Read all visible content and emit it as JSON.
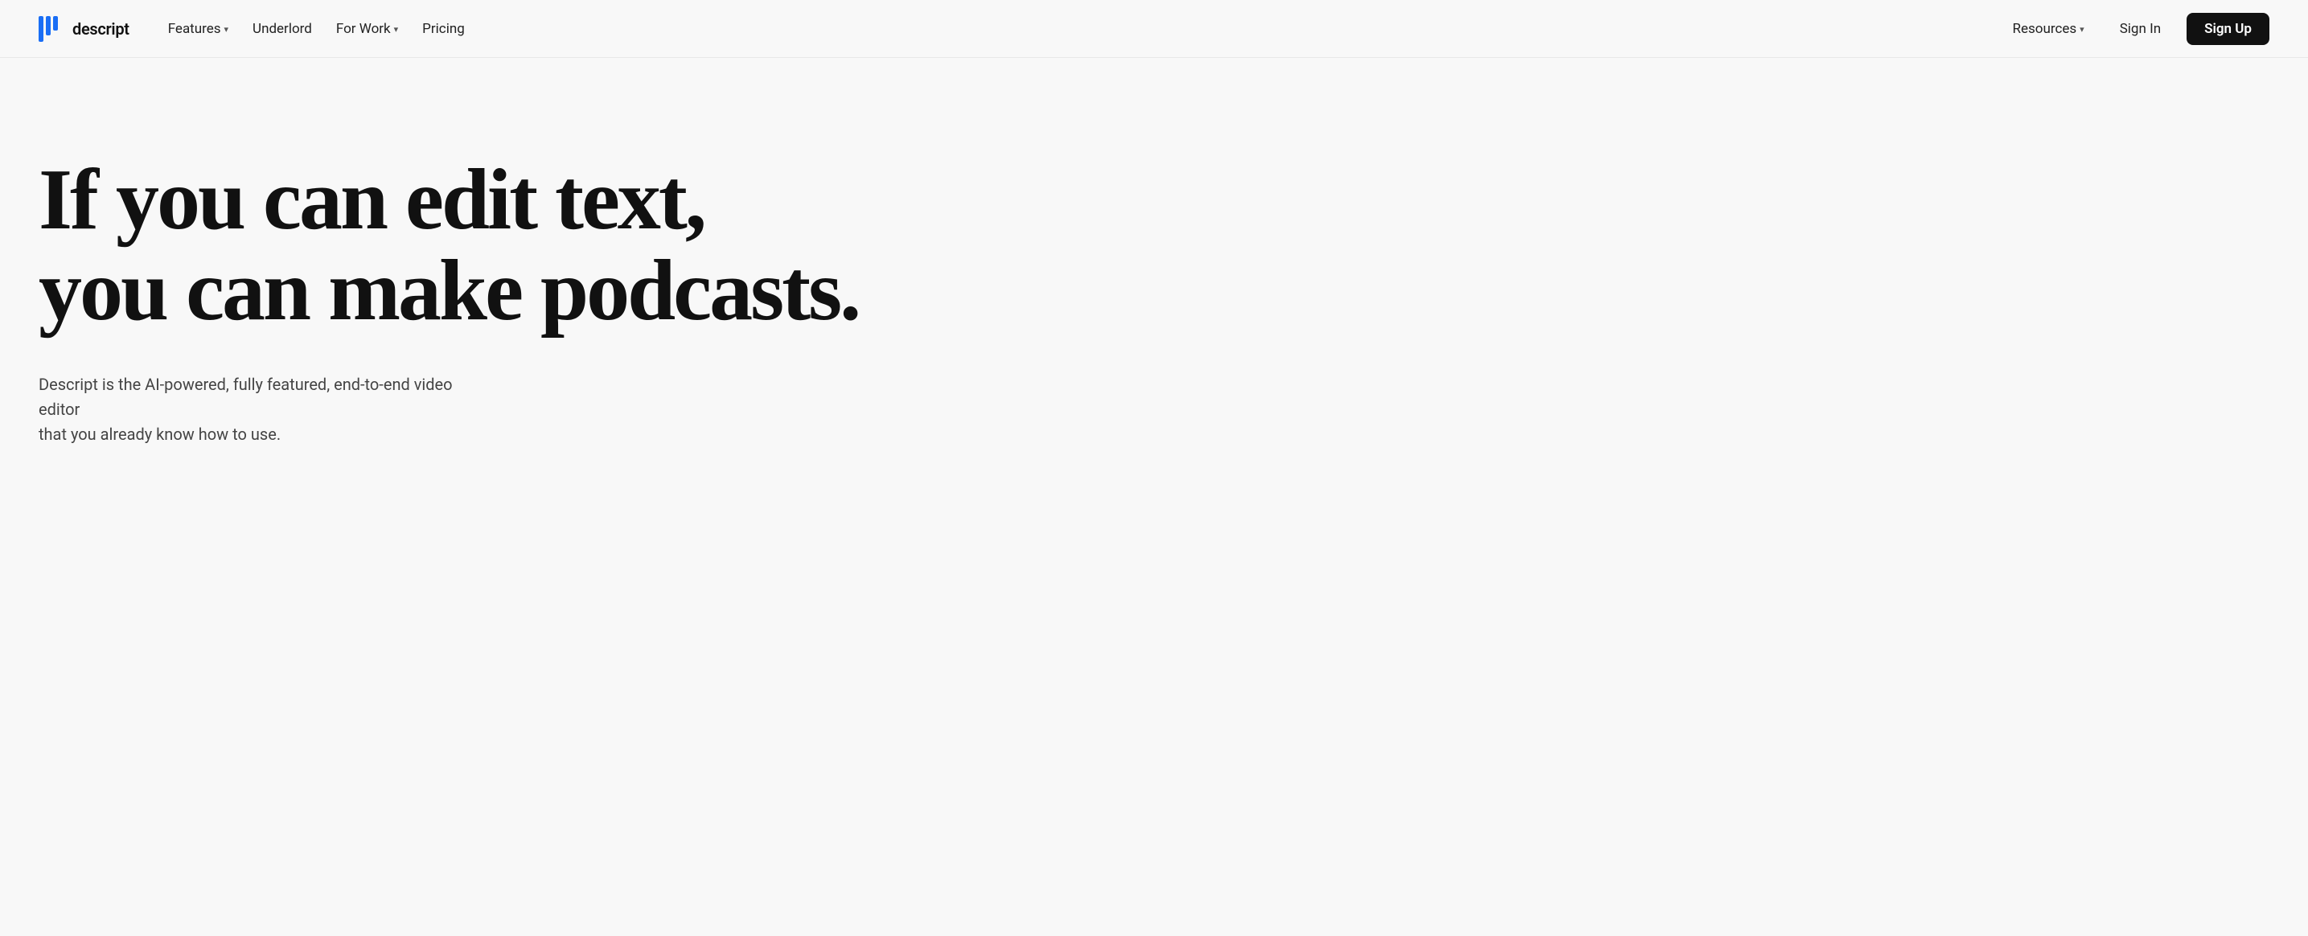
{
  "nav": {
    "logo": {
      "text": "descript",
      "icon_name": "descript-logo-icon"
    },
    "left_links": [
      {
        "label": "Features",
        "has_dropdown": true,
        "id": "features"
      },
      {
        "label": "Underlord",
        "has_dropdown": false,
        "id": "underlord"
      },
      {
        "label": "For Work",
        "has_dropdown": true,
        "id": "for-work"
      },
      {
        "label": "Pricing",
        "has_dropdown": false,
        "id": "pricing"
      }
    ],
    "right_links": [
      {
        "label": "Resources",
        "has_dropdown": true,
        "id": "resources"
      },
      {
        "label": "Sign In",
        "has_dropdown": false,
        "id": "sign-in"
      }
    ],
    "cta": {
      "label": "Sign Up",
      "id": "sign-up"
    }
  },
  "hero": {
    "headline_line1": "If you can edit text,",
    "headline_line2": "you can make podcasts.",
    "cursor_color": "#3b5bdb",
    "subtext_line1": "Descript is the AI-powered, fully featured, end-to-end video editor",
    "subtext_line2": "that you already know how to use."
  }
}
